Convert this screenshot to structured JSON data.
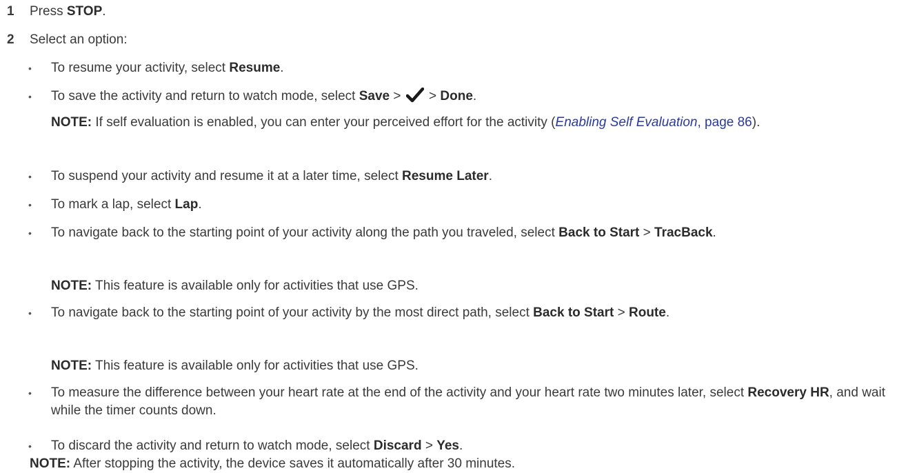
{
  "steps": [
    {
      "num": "1",
      "pre": "Press ",
      "bold": "STOP",
      "post": "."
    },
    {
      "num": "2",
      "text": "Select an option:"
    }
  ],
  "bullet_glyph": "•",
  "b1": {
    "pre": "To resume your activity, select ",
    "bold": "Resume",
    "post": "."
  },
  "b2": {
    "pre": "To save the activity and return to watch mode, select ",
    "bold1": "Save",
    "sep1": " > ",
    "sep2": " > ",
    "bold2": "Done",
    "post": ".",
    "icon": "checkmark-icon"
  },
  "note1": {
    "label": "NOTE:",
    "text": " If self evaluation is enabled, you can enter your perceived effort for the activity (",
    "link": "Enabling Self Evaluation",
    "page": ", page 86",
    "close": ")."
  },
  "b3": {
    "pre": "To suspend your activity and resume it at a later time, select ",
    "bold": "Resume Later",
    "post": "."
  },
  "b4": {
    "pre": "To mark a lap, select ",
    "bold": "Lap",
    "post": "."
  },
  "b5": {
    "pre": "To navigate back to the starting point of your activity along the path you traveled, select ",
    "bold1": "Back to Start",
    "sep": " > ",
    "bold2": "TracBack",
    "post": "."
  },
  "note2": {
    "label": "NOTE:",
    "text": " This feature is available only for activities that use GPS."
  },
  "b6": {
    "pre": "To navigate back to the starting point of your activity by the most direct path, select ",
    "bold1": "Back to Start",
    "sep": " > ",
    "bold2": "Route",
    "post": "."
  },
  "note3": {
    "label": "NOTE:",
    "text": " This feature is available only for activities that use GPS."
  },
  "b7": {
    "pre": "To measure the difference between your heart rate at the end of the activity and your heart rate two minutes later, select ",
    "bold": "Recovery HR",
    "post": ", and wait while the timer counts down."
  },
  "b8": {
    "pre": "To discard the activity and return to watch mode, select ",
    "bold1": "Discard",
    "sep": " > ",
    "bold2": "Yes",
    "post": "."
  },
  "note4": {
    "label": "NOTE:",
    "text": " After stopping the activity, the device saves it automatically after 30 minutes."
  },
  "colors": {
    "text": "#3a3a3a",
    "link": "#2a3a9c"
  }
}
